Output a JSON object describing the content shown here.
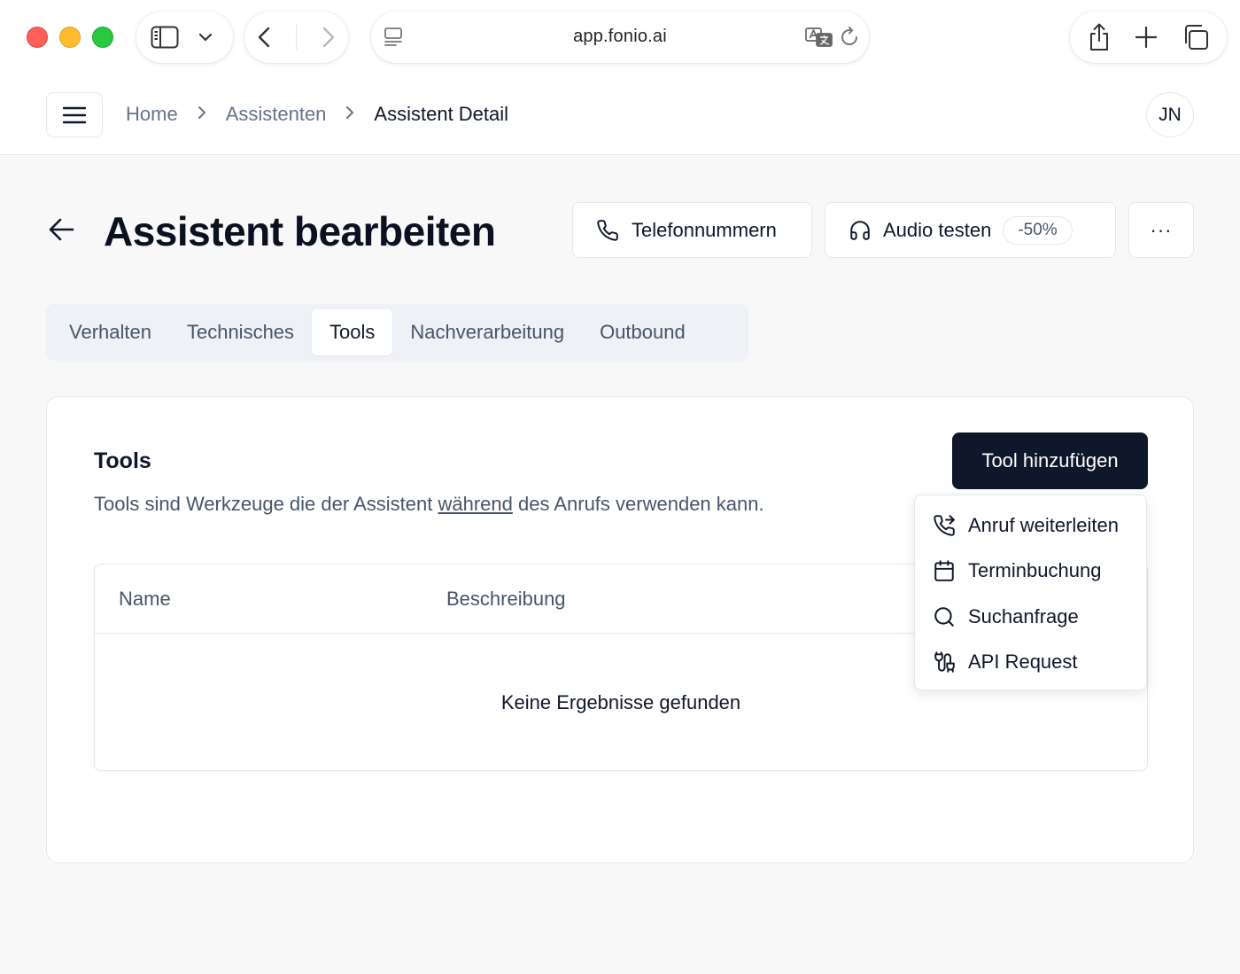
{
  "browser": {
    "url": "app.fonio.ai",
    "icons": {
      "sidebar_toggle": "sidebar-icon",
      "sidebar_menu": "chevron-down-icon",
      "back": "chevron-left-icon",
      "forward": "chevron-right-icon",
      "reader": "reader-icon",
      "translate": "translate-icon",
      "reload": "reload-icon",
      "share": "share-icon",
      "new_tab": "plus-icon",
      "tabs": "tabs-overview-icon"
    }
  },
  "header": {
    "breadcrumb": [
      {
        "label": "Home"
      },
      {
        "label": "Assistenten"
      },
      {
        "label": "Assistent Detail"
      }
    ],
    "avatar_initials": "JN"
  },
  "page": {
    "title": "Assistent bearbeiten",
    "actions": {
      "phone_label": "Telefonnummern",
      "audio_label": "Audio testen",
      "audio_badge": "-50%",
      "more_label": "···"
    }
  },
  "tabs": [
    {
      "label": "Verhalten",
      "active": false
    },
    {
      "label": "Technisches",
      "active": false
    },
    {
      "label": "Tools",
      "active": true
    },
    {
      "label": "Nachverarbeitung",
      "active": false
    },
    {
      "label": "Outbound",
      "active": false
    }
  ],
  "tools_card": {
    "title": "Tools",
    "description_before": "Tools sind Werkzeuge die der Assistent ",
    "description_link": "während",
    "description_after": " des Anrufs verwenden kann.",
    "add_button": "Tool hinzufügen",
    "table": {
      "columns": [
        "Name",
        "Beschreibung"
      ],
      "empty_text": "Keine Ergebnisse gefunden"
    }
  },
  "dropdown": {
    "items": [
      {
        "label": "Anruf weiterleiten",
        "icon": "phone-forward-icon"
      },
      {
        "label": "Terminbuchung",
        "icon": "calendar-icon"
      },
      {
        "label": "Suchanfrage",
        "icon": "search-icon"
      },
      {
        "label": "API Request",
        "icon": "api-route-icon"
      }
    ]
  },
  "colors": {
    "primary": "#0f172a",
    "muted_text": "#64748b",
    "border": "#e2e8f0",
    "tab_bg": "#eef1f5",
    "page_bg": "#f8f8f9"
  }
}
